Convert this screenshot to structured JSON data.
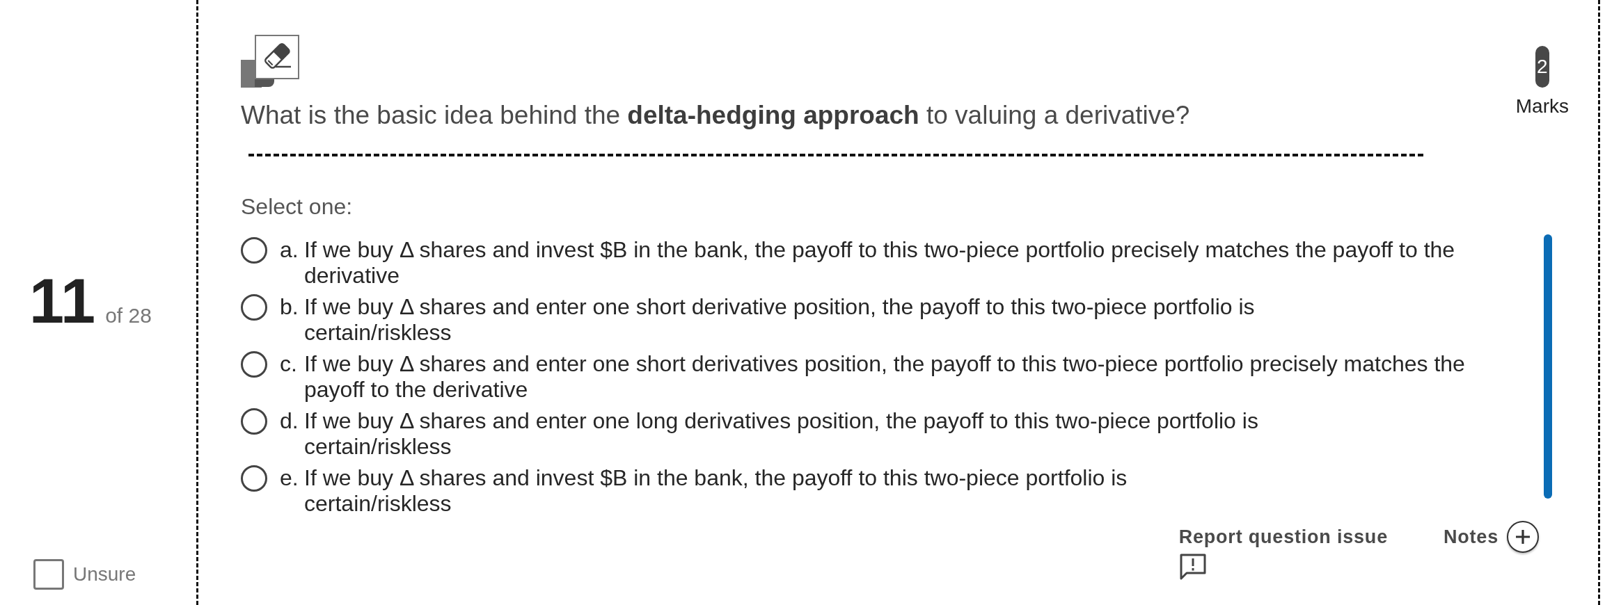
{
  "question_nav": {
    "number": "11",
    "total": "of 28"
  },
  "unsure": {
    "label": "Unsure",
    "checked": false
  },
  "question": {
    "text": "What is the basic idea behind the **delta-hedging approach** to valuing a derivative?",
    "marks": {
      "value": "2",
      "label": "Marks"
    }
  },
  "prompt": "Select one:",
  "options": [
    {
      "letter": "a.",
      "text": "If we buy Δ shares and invest $B in the bank, the payoff to this two-piece portfolio precisely matches the payoff to the derivative",
      "selected": false
    },
    {
      "letter": "b.",
      "text": "If we buy Δ shares and enter one short derivative position, the payoff to this two-piece portfolio is\ncertain/riskless",
      "selected": false
    },
    {
      "letter": "c.",
      "text": "If we buy Δ shares and enter one short derivatives position, the payoff to this two-piece portfolio precisely matches the payoff to the derivative",
      "selected": false
    },
    {
      "letter": "d.",
      "text": "If we buy Δ shares and enter one long derivatives position, the payoff to this two-piece portfolio is\ncertain/riskless",
      "selected": false
    },
    {
      "letter": "e.",
      "text": "If we buy Δ shares and invest $B in the bank, the payoff to this two-piece portfolio is\ncertain/riskless",
      "selected": false
    }
  ],
  "footer": {
    "report": "Report question issue",
    "notes": "Notes"
  }
}
